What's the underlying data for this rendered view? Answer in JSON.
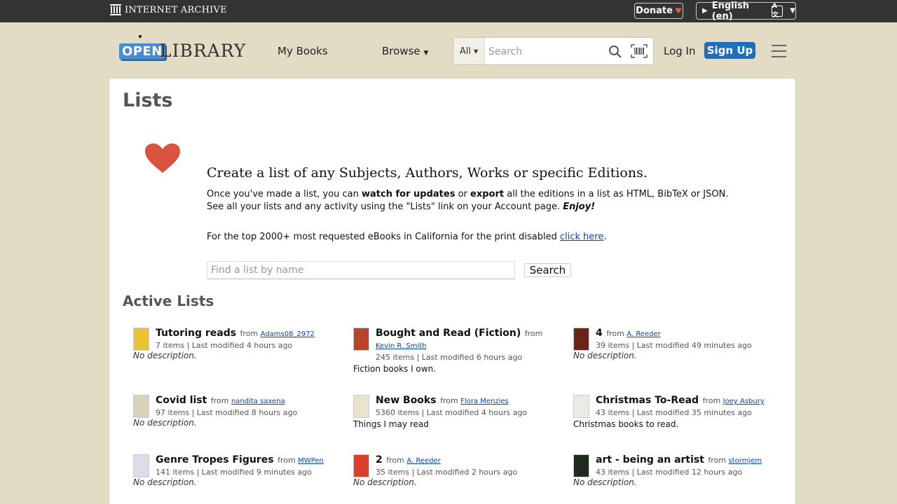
{
  "topbar": {
    "ia_logo": "INTERNET ARCHIVE",
    "donate": "Donate",
    "language": "English (en)"
  },
  "header": {
    "logo_open": "OPEN",
    "logo_library": "LIBRARY",
    "my_books": "My Books",
    "browse": "Browse",
    "search_scope": "All",
    "search_placeholder": "Search",
    "login": "Log In",
    "signup": "Sign Up"
  },
  "page": {
    "title": "Lists",
    "create_title": "Create a list of any Subjects, Authors, Works or specific Editions.",
    "desc_1": "Once you've made a list, you can ",
    "desc_watch": "watch for updates",
    "desc_2": " or ",
    "desc_export": "export",
    "desc_3": " all the editions in a list as HTML, BibTeX or JSON. See all your lists and any activity using the \"Lists\" link on your Account page. ",
    "desc_enjoy": "Enjoy!",
    "print_note": "For the top 2000+ most requested eBooks in California for the print disabled ",
    "print_link": "click here",
    "print_end": ".",
    "find_placeholder": "Find a list by name",
    "find_button": "Search",
    "active_title": "Active Lists"
  },
  "lists": [
    {
      "title": "Tutoring reads",
      "from": "from",
      "owner": "Adams08_2972",
      "meta": "7 items | Last modified 4 hours ago",
      "desc": "No description.",
      "nodesc": true,
      "cover": "#e8c530"
    },
    {
      "title": "Bought and Read (Fiction)",
      "from": "from",
      "owner": "Kevin R. Smith",
      "meta": "245 items | Last modified 6 hours ago",
      "desc": "Fiction books I own.",
      "nodesc": false,
      "cover": "#b8452a"
    },
    {
      "title": "4",
      "from": "from",
      "owner": "A. Reeder",
      "meta": "39 items | Last modified 49 minutes ago",
      "desc": "No description.",
      "nodesc": true,
      "cover": "#6a2418"
    },
    {
      "title": "Covid list",
      "from": "from",
      "owner": "nandita saxena",
      "meta": "97 items | Last modified 8 hours ago",
      "desc": "No description.",
      "nodesc": true,
      "cover": "#d9d2b8"
    },
    {
      "title": "New Books",
      "from": "from",
      "owner": "Flora Menzies",
      "meta": "5360 items | Last modified 4 hours ago",
      "desc": "Things I may read",
      "nodesc": false,
      "cover": "#ece3cc"
    },
    {
      "title": "Christmas To-Read",
      "from": "from",
      "owner": "Joey Asbury",
      "meta": "43 items | Last modified 35 minutes ago",
      "desc": "Christmas books to read.",
      "nodesc": false,
      "cover": "#e9ece4"
    },
    {
      "title": "Genre Tropes Figures",
      "from": "from",
      "owner": "MWPen",
      "meta": "141 items | Last modified 9 minutes ago",
      "desc": "No description.",
      "nodesc": true,
      "cover": "#dcdde8"
    },
    {
      "title": "2",
      "from": "from",
      "owner": "A. Reeder",
      "meta": "35 items | Last modified 2 hours ago",
      "desc": "No description.",
      "nodesc": true,
      "cover": "#d8402c"
    },
    {
      "title": "art - being an artist",
      "from": "from",
      "owner": "stormjem",
      "meta": "43 items | Last modified 12 hours ago",
      "desc": "No description.",
      "nodesc": true,
      "cover": "#1f2a1c"
    }
  ]
}
